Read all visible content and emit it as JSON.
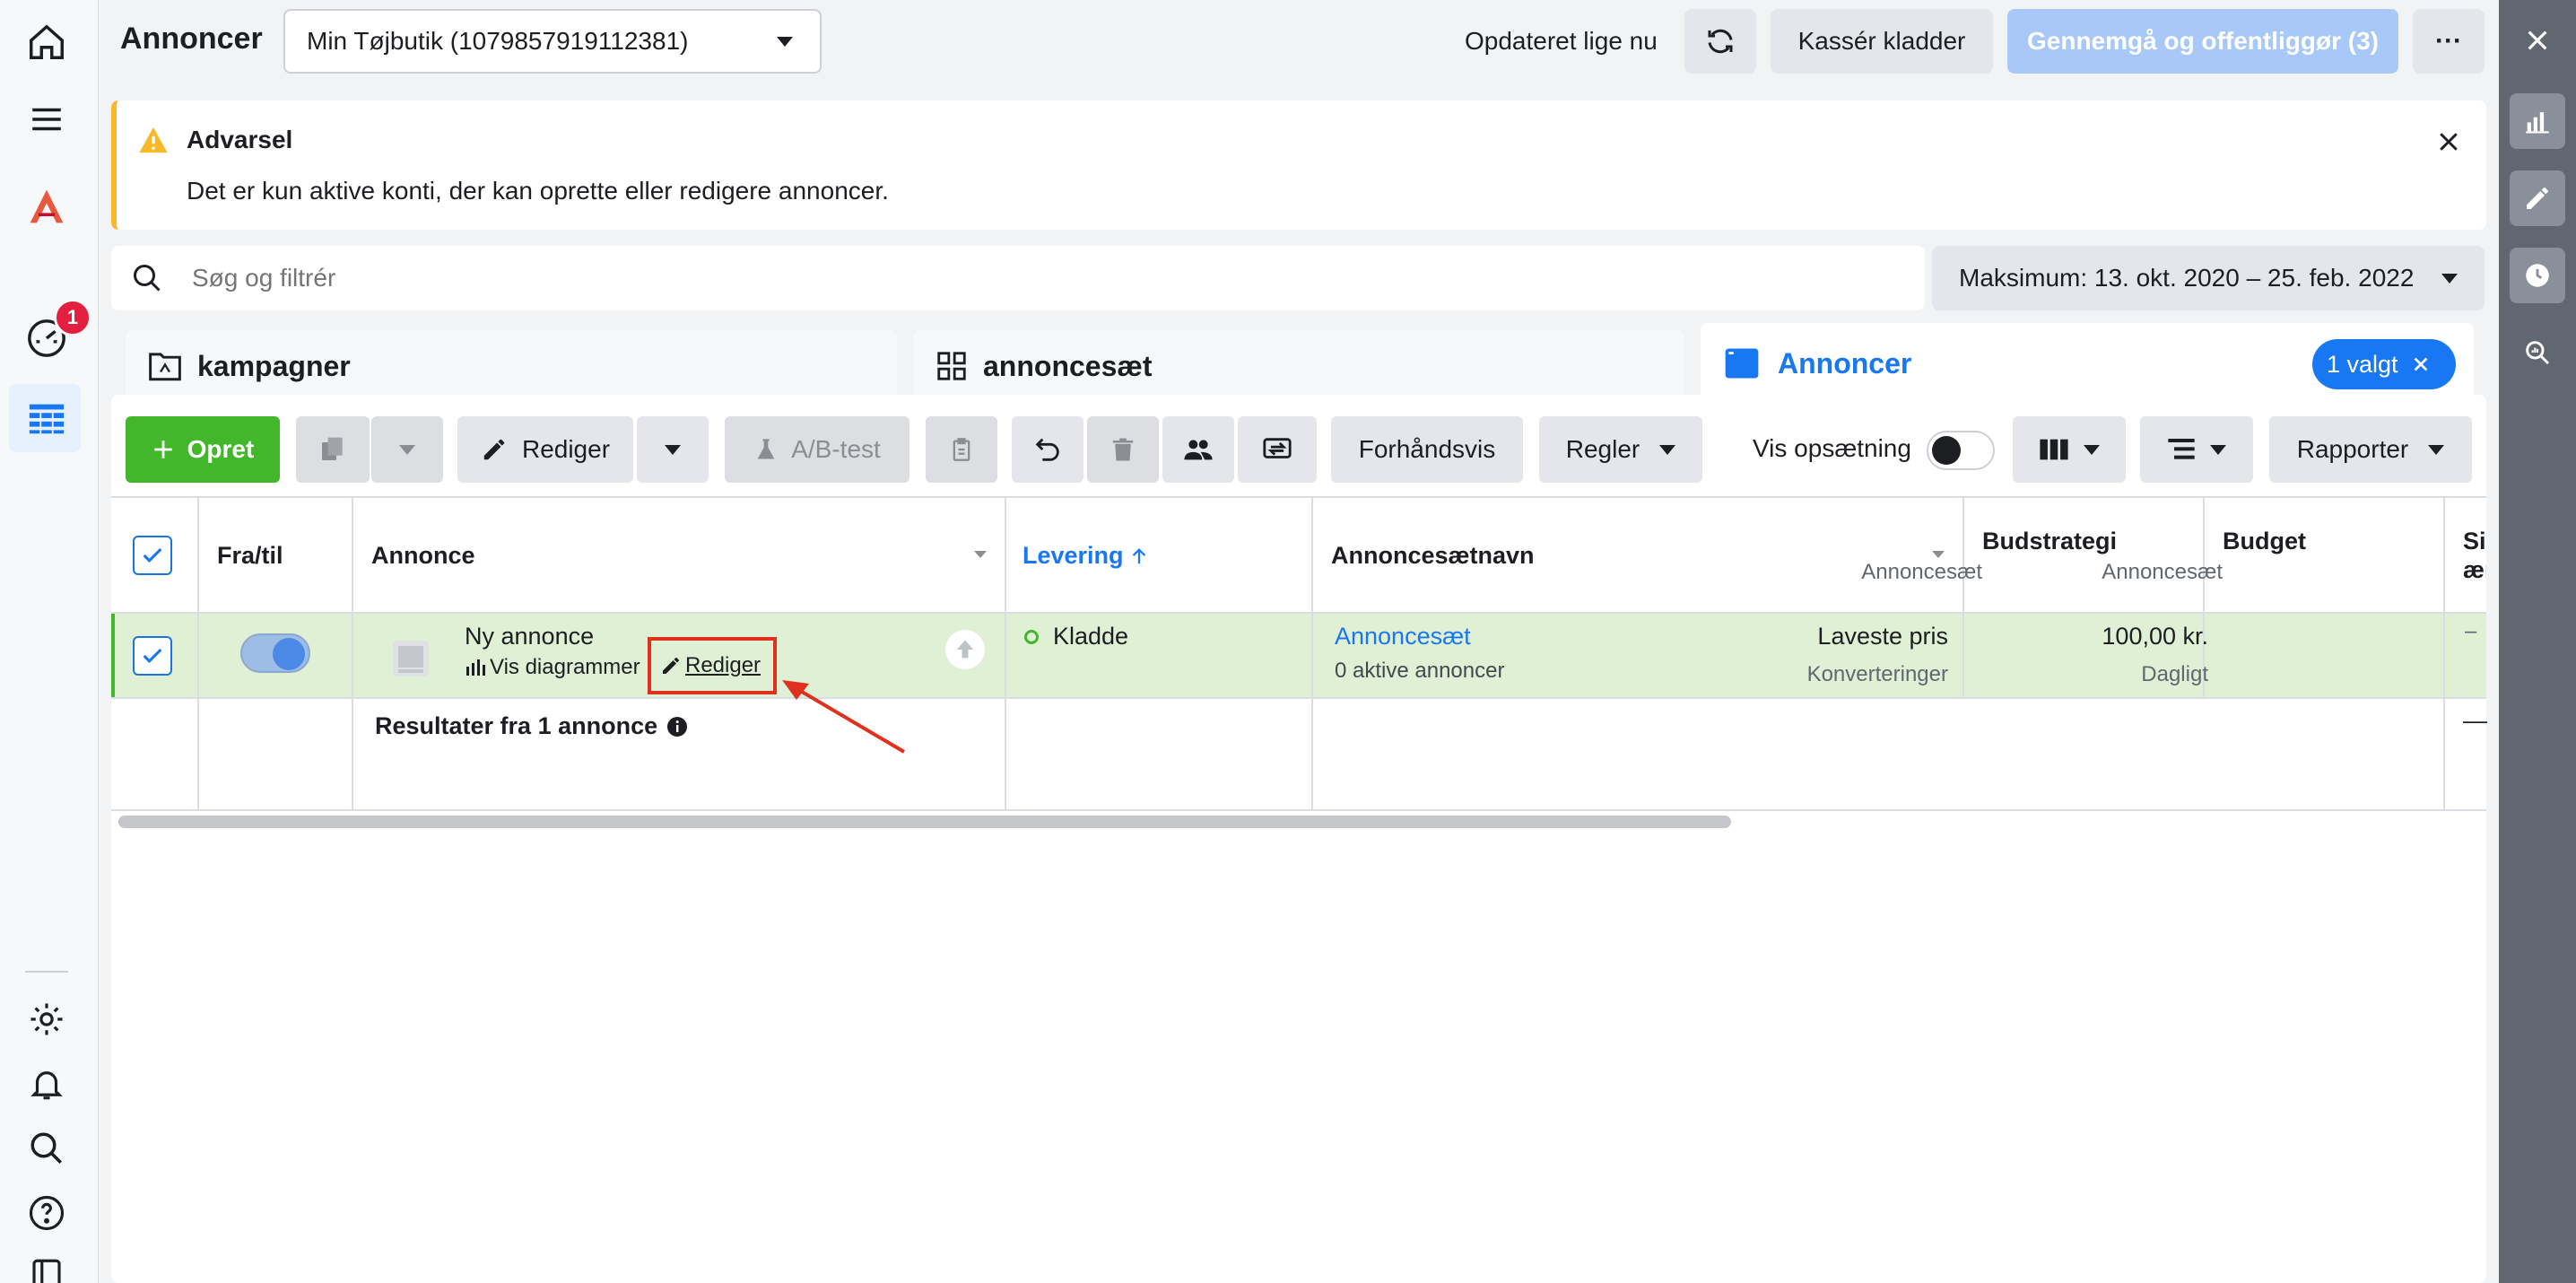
{
  "header": {
    "title": "Annoncer",
    "account": "Min Tøjbutik (1079857919112381)",
    "updated": "Opdateret lige nu",
    "discard_label": "Kassér kladder",
    "publish_label": "Gennemgå og offentliggør (3)",
    "more_label": "···"
  },
  "warning": {
    "title": "Advarsel",
    "text": "Det er kun aktive konti, der kan oprette eller redigere annoncer."
  },
  "search": {
    "placeholder": "Søg og filtrér"
  },
  "date_range": "Maksimum: 13. okt. 2020 – 25. feb. 2022",
  "nav": {
    "notification_count": "1"
  },
  "tabs": {
    "campaigns": "kampagner",
    "adsets": "annoncesæt",
    "ads": "Annoncer",
    "selected": "1 valgt"
  },
  "toolbar": {
    "create": "Opret",
    "edit": "Rediger",
    "ab_test": "A/B-test",
    "preview": "Forhåndsvis",
    "rules": "Regler",
    "view_setup": "Vis opsætning",
    "reports": "Rapporter"
  },
  "columns": {
    "onoff": "Fra/til",
    "ad": "Annonce",
    "delivery": "Levering",
    "adset_name": "Annoncesætnavn",
    "bid_strategy": "Budstrategi",
    "bid_strategy_sub": "Annoncesæt",
    "budget": "Budget",
    "budget_sub": "Annoncesæt",
    "cut": "Si",
    "cut2": "æn"
  },
  "row": {
    "ad_name": "Ny annonce",
    "charts_link": "Vis diagrammer",
    "edit_link": "Rediger",
    "delivery": "Kladde",
    "adset": "Annoncesæt",
    "adset_sub": "0 aktive annoncer",
    "bid": "Laveste pris",
    "bid_sub": "Konverteringer",
    "budget": "100,00 kr.",
    "budget_sub": "Dagligt",
    "dash": "–"
  },
  "results": {
    "label": "Resultater fra 1 annonce",
    "dash": "—"
  },
  "colors": {
    "accent": "#1877f2",
    "green": "#42b72a",
    "row_selected": "#e0f0d4",
    "highlight": "#e0301e"
  }
}
